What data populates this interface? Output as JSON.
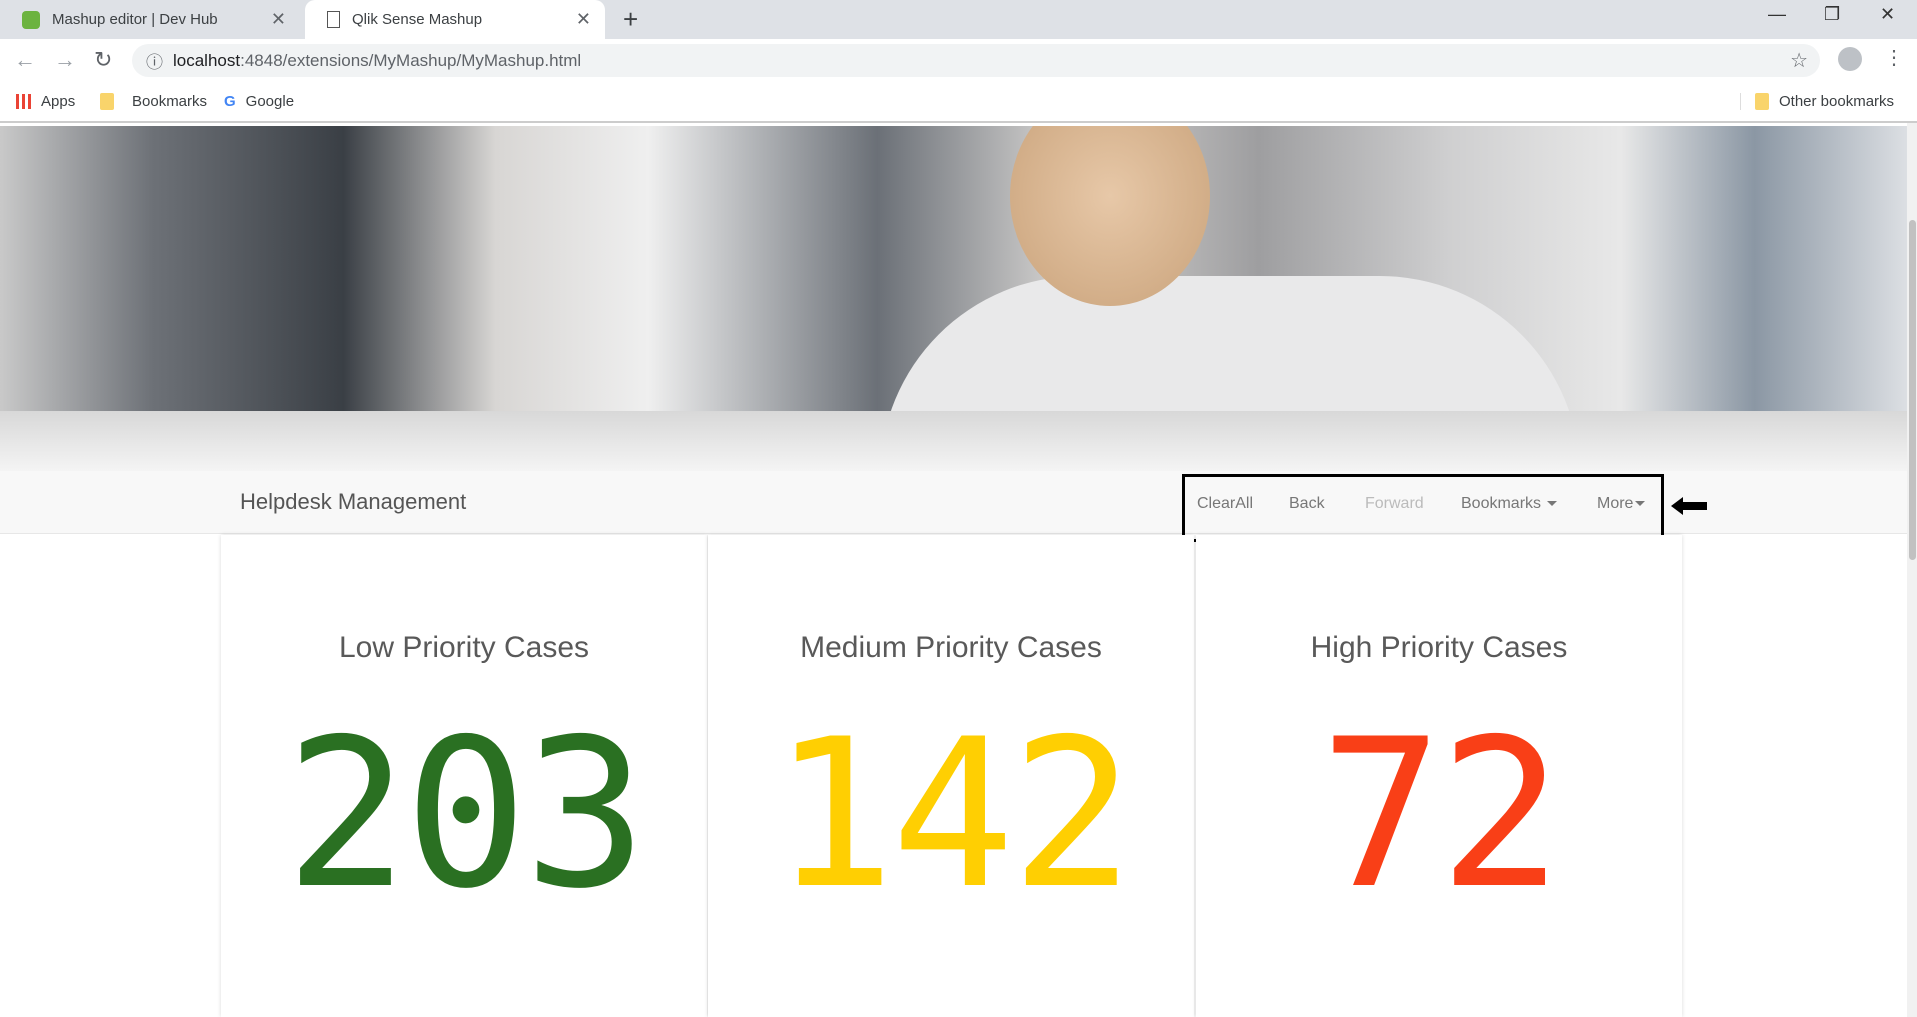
{
  "browser": {
    "tabs": [
      {
        "title": "Mashup editor | Dev Hub",
        "icon": "qlik-icon"
      },
      {
        "title": "Qlik Sense Mashup",
        "icon": "page-icon",
        "active": true
      }
    ],
    "url_host": "localhost",
    "url_path": ":4848/extensions/MyMashup/MyMashup.html",
    "bookmarks": [
      "Apps",
      "Bookmarks",
      "Google"
    ],
    "other_bookmarks": "Other bookmarks"
  },
  "navbar": {
    "brand": "Helpdesk Management",
    "items": {
      "clear": "ClearAll",
      "back": "Back",
      "forward": "Forward",
      "bookmarks": "Bookmarks",
      "more": "More"
    }
  },
  "kpis": [
    {
      "title": "Low Priority Cases",
      "value": "203",
      "color": "#2a7022"
    },
    {
      "title": "Medium Priority Cases",
      "value": "142",
      "color": "#ffcf02"
    },
    {
      "title": "High Priority Cases",
      "value": "72",
      "color": "#f93f17"
    }
  ]
}
